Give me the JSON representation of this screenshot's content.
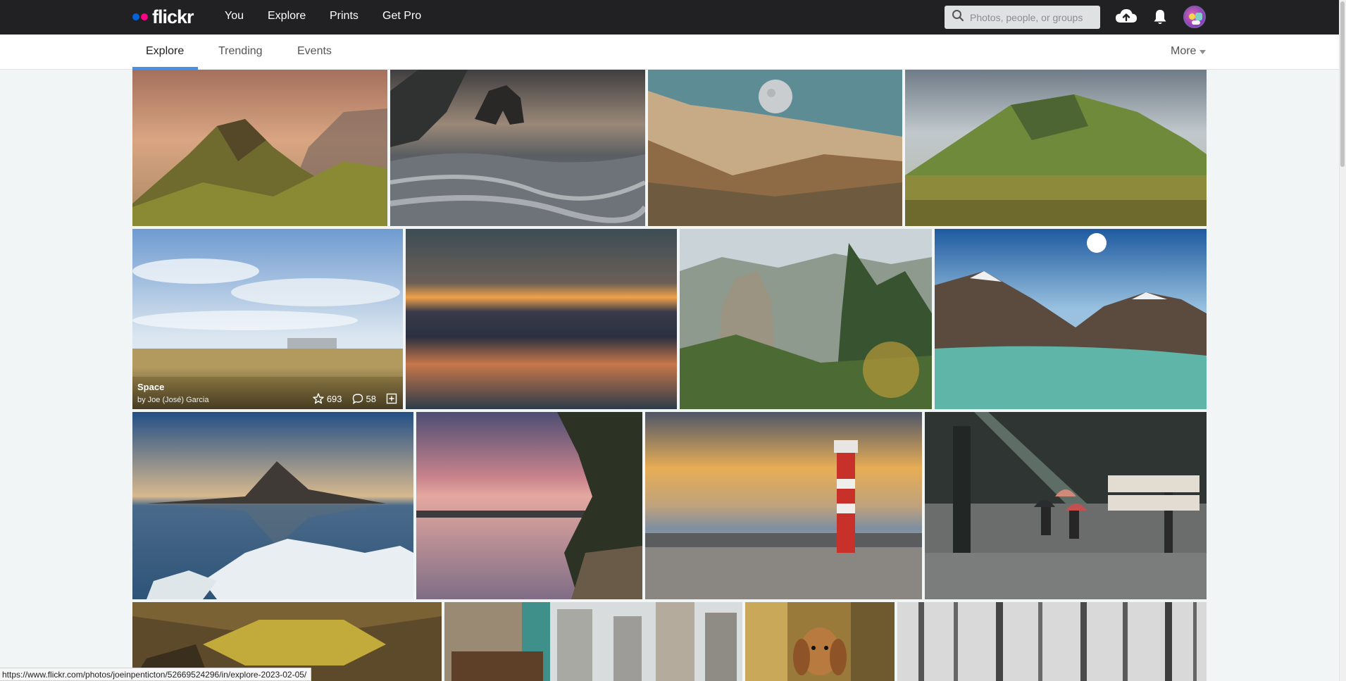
{
  "header": {
    "logo_text": "flickr",
    "logo_colors": {
      "blue": "#0063dc",
      "pink": "#ff0084"
    },
    "nav": [
      {
        "label": "You"
      },
      {
        "label": "Explore"
      },
      {
        "label": "Prints"
      },
      {
        "label": "Get Pro"
      }
    ],
    "search_placeholder": "Photos, people, or groups",
    "icons": [
      "search-icon",
      "upload-cloud-icon",
      "notifications-bell-icon",
      "avatar"
    ]
  },
  "subnav": {
    "tabs": [
      {
        "label": "Explore",
        "active": true
      },
      {
        "label": "Trending",
        "active": false
      },
      {
        "label": "Events",
        "active": false
      }
    ],
    "more_label": "More",
    "accent_color": "#4a90e2"
  },
  "hovered_photo": {
    "title": "Space",
    "author": "by Joe (José) Garcia",
    "faves": "693",
    "comments": "58"
  },
  "photos": [
    {
      "subject": "mountain-ridge-sunset"
    },
    {
      "subject": "sea-stack-waves"
    },
    {
      "subject": "moon-over-hills"
    },
    {
      "subject": "green-volcano-plain"
    },
    {
      "subject": "prairie-grain-silos"
    },
    {
      "subject": "long-exposure-sunset-sea"
    },
    {
      "subject": "rock-pinnacles-forest"
    },
    {
      "subject": "alpine-lake-sun"
    },
    {
      "subject": "kirkjufell-ice"
    },
    {
      "subject": "lake-pink-clouds"
    },
    {
      "subject": "lighthouse-sunset"
    },
    {
      "subject": "rainy-station-umbrellas"
    },
    {
      "subject": "yellow-tunnel-ceiling"
    },
    {
      "subject": "city-towers"
    },
    {
      "subject": "dachshund-portrait"
    },
    {
      "subject": "snowy-forest"
    }
  ],
  "status_url": "https://www.flickr.com/photos/joeinpenticton/52669524296/in/explore-2023-02-05/"
}
